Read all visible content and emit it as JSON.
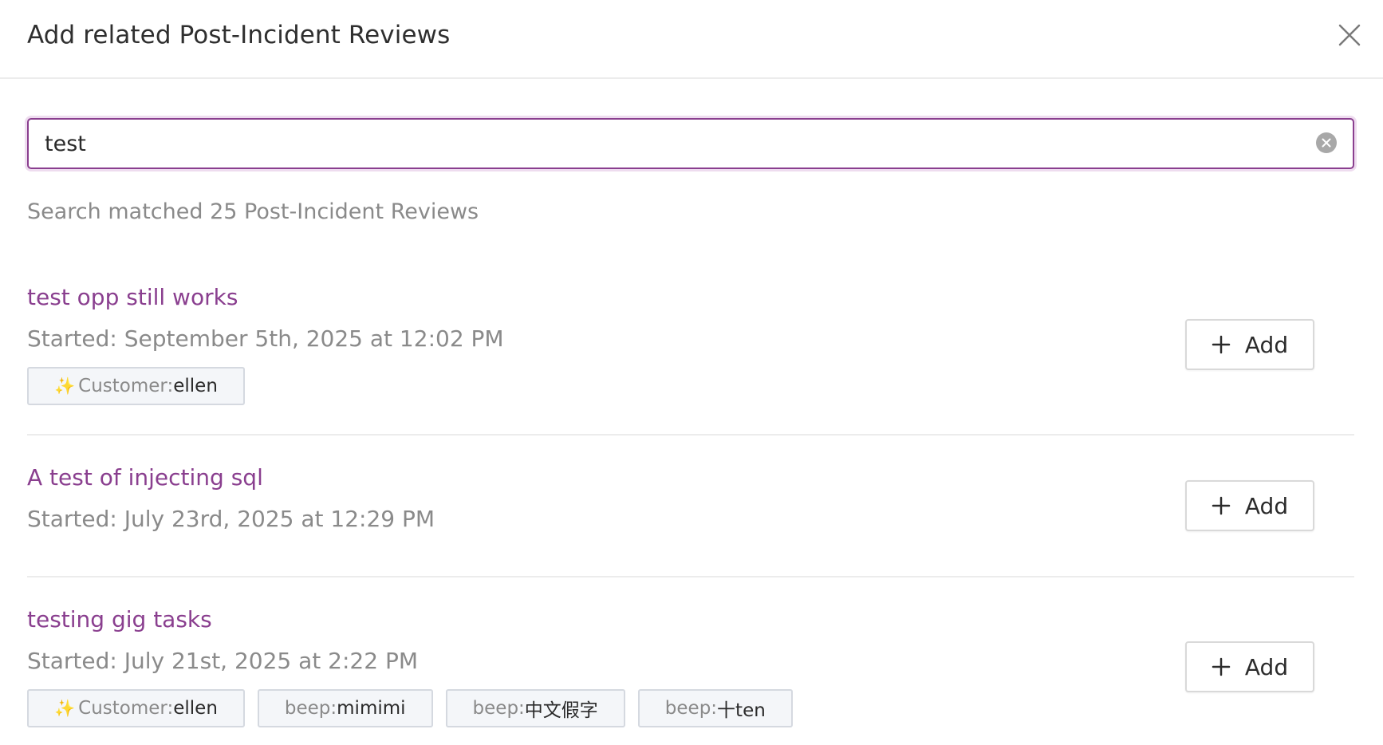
{
  "header": {
    "title": "Add related Post-Incident Reviews"
  },
  "search": {
    "value": "test"
  },
  "match_count": "Search matched 25 Post-Incident Reviews",
  "results": [
    {
      "title": "test opp still works",
      "date": "Started: September 5th, 2025 at 12:02 PM",
      "add_label": "Add",
      "tags": [
        {
          "sparkle": "✨",
          "key": "Customer:",
          "value": "ellen"
        }
      ]
    },
    {
      "title": "A test of injecting sql",
      "date": "Started: July 23rd, 2025 at 12:29 PM",
      "add_label": "Add",
      "tags": []
    },
    {
      "title": "testing gig tasks",
      "date": "Started: July 21st, 2025 at 2:22 PM",
      "add_label": "Add",
      "tags": [
        {
          "sparkle": "✨",
          "key": "Customer:",
          "value": "ellen"
        },
        {
          "key": "beep:",
          "value": "mimimi"
        },
        {
          "key": "beep:",
          "value": "中文假字"
        },
        {
          "key": "beep:",
          "value": "十ten"
        }
      ]
    }
  ],
  "icons": {
    "close": "close-icon",
    "clear": "clear-circle-icon",
    "add": "plus-icon",
    "sparkle": "sparkles-icon"
  },
  "colors": {
    "accent": "#8a3f8f",
    "muted_text": "#8a8a8a",
    "tag_bg": "#f4f6f9"
  }
}
